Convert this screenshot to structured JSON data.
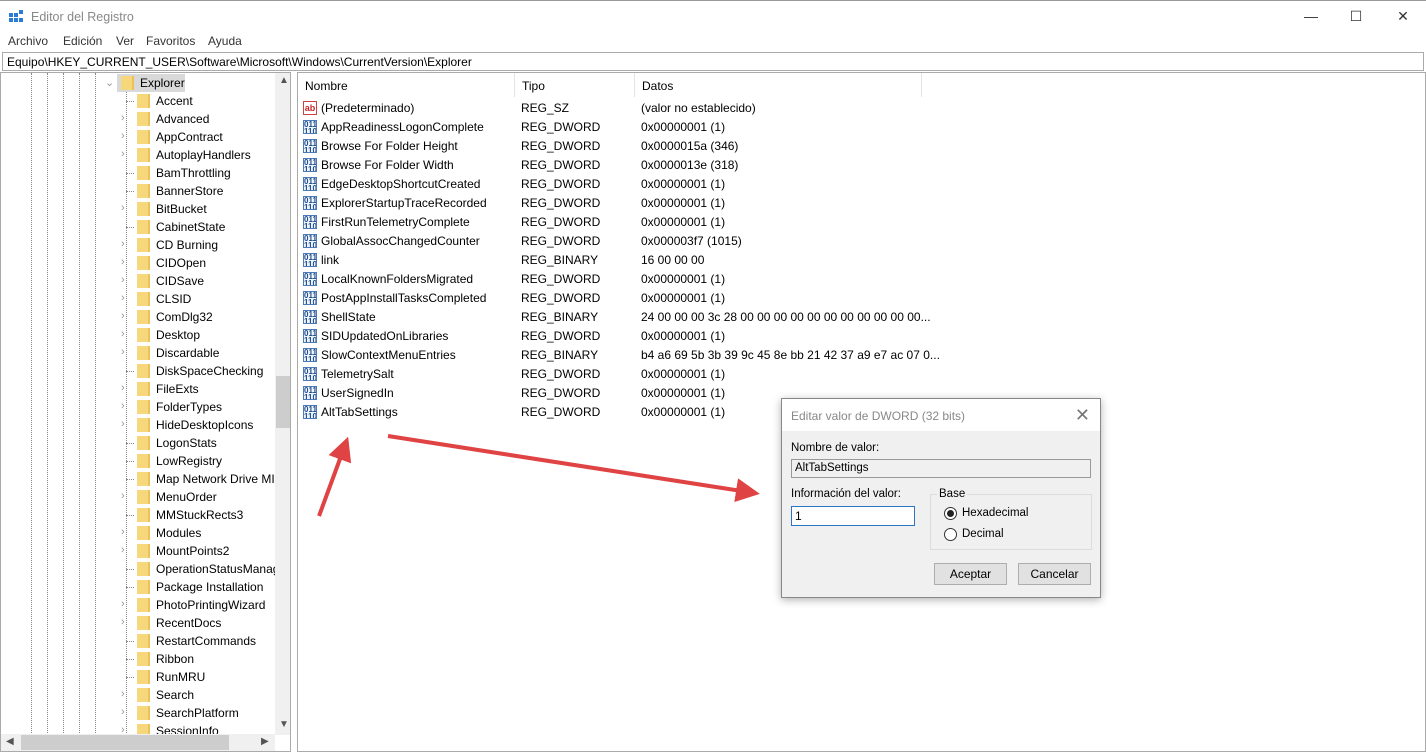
{
  "window": {
    "title": "Editor del Registro",
    "minimize": "—",
    "maximize": "☐",
    "close": "✕"
  },
  "menu": [
    "Archivo",
    "Edición",
    "Ver",
    "Favoritos",
    "Ayuda"
  ],
  "address": "Equipo\\HKEY_CURRENT_USER\\Software\\Microsoft\\Windows\\CurrentVersion\\Explorer",
  "tree": {
    "selected": "Explorer",
    "items": [
      {
        "label": "Accent",
        "expandable": false
      },
      {
        "label": "Advanced",
        "expandable": true
      },
      {
        "label": "AppContract",
        "expandable": true
      },
      {
        "label": "AutoplayHandlers",
        "expandable": true
      },
      {
        "label": "BamThrottling",
        "expandable": false
      },
      {
        "label": "BannerStore",
        "expandable": false
      },
      {
        "label": "BitBucket",
        "expandable": true
      },
      {
        "label": "CabinetState",
        "expandable": false
      },
      {
        "label": "CD Burning",
        "expandable": true
      },
      {
        "label": "CIDOpen",
        "expandable": true
      },
      {
        "label": "CIDSave",
        "expandable": true
      },
      {
        "label": "CLSID",
        "expandable": true
      },
      {
        "label": "ComDlg32",
        "expandable": true
      },
      {
        "label": "Desktop",
        "expandable": true
      },
      {
        "label": "Discardable",
        "expandable": true
      },
      {
        "label": "DiskSpaceChecking",
        "expandable": false
      },
      {
        "label": "FileExts",
        "expandable": true
      },
      {
        "label": "FolderTypes",
        "expandable": true
      },
      {
        "label": "HideDesktopIcons",
        "expandable": true
      },
      {
        "label": "LogonStats",
        "expandable": false
      },
      {
        "label": "LowRegistry",
        "expandable": false
      },
      {
        "label": "Map Network Drive MI",
        "expandable": false
      },
      {
        "label": "MenuOrder",
        "expandable": true
      },
      {
        "label": "MMStuckRects3",
        "expandable": false
      },
      {
        "label": "Modules",
        "expandable": true
      },
      {
        "label": "MountPoints2",
        "expandable": true
      },
      {
        "label": "OperationStatusManag",
        "expandable": false
      },
      {
        "label": "Package Installation",
        "expandable": false
      },
      {
        "label": "PhotoPrintingWizard",
        "expandable": true
      },
      {
        "label": "RecentDocs",
        "expandable": true
      },
      {
        "label": "RestartCommands",
        "expandable": false
      },
      {
        "label": "Ribbon",
        "expandable": false
      },
      {
        "label": "RunMRU",
        "expandable": false
      },
      {
        "label": "Search",
        "expandable": true
      },
      {
        "label": "SearchPlatform",
        "expandable": true
      },
      {
        "label": "SessionInfo",
        "expandable": true
      }
    ]
  },
  "list": {
    "columns": [
      "Nombre",
      "Tipo",
      "Datos"
    ],
    "rows": [
      {
        "name": "(Predeterminado)",
        "type": "REG_SZ",
        "data": "(valor no establecido)",
        "icon": "ab"
      },
      {
        "name": "AppReadinessLogonComplete",
        "type": "REG_DWORD",
        "data": "0x00000001 (1)",
        "icon": "bin"
      },
      {
        "name": "Browse For Folder Height",
        "type": "REG_DWORD",
        "data": "0x0000015a (346)",
        "icon": "bin"
      },
      {
        "name": "Browse For Folder Width",
        "type": "REG_DWORD",
        "data": "0x0000013e (318)",
        "icon": "bin"
      },
      {
        "name": "EdgeDesktopShortcutCreated",
        "type": "REG_DWORD",
        "data": "0x00000001 (1)",
        "icon": "bin"
      },
      {
        "name": "ExplorerStartupTraceRecorded",
        "type": "REG_DWORD",
        "data": "0x00000001 (1)",
        "icon": "bin"
      },
      {
        "name": "FirstRunTelemetryComplete",
        "type": "REG_DWORD",
        "data": "0x00000001 (1)",
        "icon": "bin"
      },
      {
        "name": "GlobalAssocChangedCounter",
        "type": "REG_DWORD",
        "data": "0x000003f7 (1015)",
        "icon": "bin"
      },
      {
        "name": "link",
        "type": "REG_BINARY",
        "data": "16 00 00 00",
        "icon": "bin"
      },
      {
        "name": "LocalKnownFoldersMigrated",
        "type": "REG_DWORD",
        "data": "0x00000001 (1)",
        "icon": "bin"
      },
      {
        "name": "PostAppInstallTasksCompleted",
        "type": "REG_DWORD",
        "data": "0x00000001 (1)",
        "icon": "bin"
      },
      {
        "name": "ShellState",
        "type": "REG_BINARY",
        "data": "24 00 00 00 3c 28 00 00 00 00 00 00 00 00 00 00 00...",
        "icon": "bin"
      },
      {
        "name": "SIDUpdatedOnLibraries",
        "type": "REG_DWORD",
        "data": "0x00000001 (1)",
        "icon": "bin"
      },
      {
        "name": "SlowContextMenuEntries",
        "type": "REG_BINARY",
        "data": "b4 a6 69 5b 3b 39 9c 45 8e bb 21 42 37 a9 e7 ac 07 0...",
        "icon": "bin"
      },
      {
        "name": "TelemetrySalt",
        "type": "REG_DWORD",
        "data": "0x00000001 (1)",
        "icon": "bin"
      },
      {
        "name": "UserSignedIn",
        "type": "REG_DWORD",
        "data": "0x00000001 (1)",
        "icon": "bin"
      },
      {
        "name": "AltTabSettings",
        "type": "REG_DWORD",
        "data": "0x00000001 (1)",
        "icon": "bin"
      }
    ]
  },
  "dialog": {
    "title": "Editar valor de DWORD (32 bits)",
    "close": "✕",
    "name_label": "Nombre de valor:",
    "name_value": "AltTabSettings",
    "value_label": "Información del valor:",
    "value": "1",
    "base_label": "Base",
    "hex_label": "Hexadecimal",
    "dec_label": "Decimal",
    "base_selected": "Hexadecimal",
    "ok": "Aceptar",
    "cancel": "Cancelar"
  },
  "colors": {
    "arrow": "#e04343",
    "selection": "#d9d9d9",
    "folder": "#f6d77c"
  }
}
